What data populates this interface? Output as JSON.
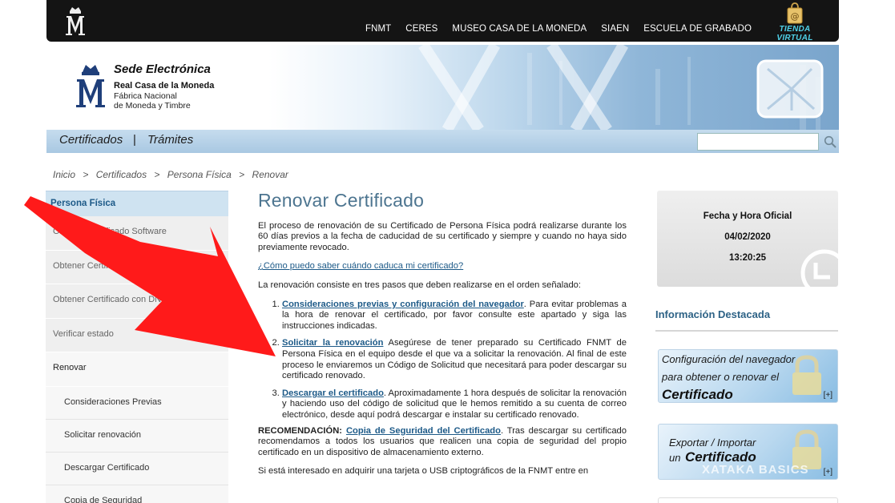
{
  "topbar": {
    "nav": [
      "FNMT",
      "CERES",
      "MUSEO CASA DE LA MONEDA",
      "SIAEN",
      "ESCUELA DE GRABADO"
    ],
    "tienda": "TIENDA VIRTUAL",
    "tienda_icon": "shopping-bag-icon"
  },
  "header": {
    "title": "Sede Electrónica",
    "org": "Real Casa de la Moneda",
    "sub1": "Fábrica Nacional",
    "sub2": "de Moneda y Timbre"
  },
  "navbar": {
    "certificados": "Certificados",
    "separator": "|",
    "tramites": "Trámites",
    "search_value": ""
  },
  "breadcrumb": [
    "Inicio",
    ">",
    "Certificados",
    ">",
    "Persona Física",
    ">",
    "Renovar"
  ],
  "sidebar": {
    "heading": "Persona Física",
    "items": [
      "Obtener Certificado Software",
      "Obtener Certificado con Android",
      "Obtener Certificado con DNIe",
      "Verificar estado",
      "Renovar"
    ],
    "subitems": [
      "Consideraciones Previas",
      "Solicitar renovación",
      "Descargar Certificado",
      "Copia de Seguridad"
    ]
  },
  "main": {
    "title": "Renovar Certificado",
    "intro": "El proceso de renovación de su Certificado de Persona Física podrá realizarse durante los 60 días previos a la fecha de caducidad de su certificado y siempre y cuando no haya sido previamente revocado.",
    "link_caduca": "¿Cómo puedo saber cuándo caduca mi certificado?",
    "steps_intro": "La renovación consiste en tres pasos que deben realizarse en el orden señalado:",
    "steps": [
      {
        "link": "Consideraciones previas y configuración del navegador",
        "text": ". Para evitar problemas a la hora de renovar el certificado, por favor consulte este apartado y siga las instrucciones indicadas."
      },
      {
        "link": "Solicitar la renovación",
        "text": " Asegúrese de tener preparado su Certificado FNMT de Persona Física en el equipo desde el que va a solicitar la renovación. Al final de este proceso le enviaremos un Código de Solicitud que necesitará para poder descargar su certificado renovado."
      },
      {
        "link": "Descargar el certificado",
        "text": ". Aproximadamente 1 hora después de solicitar la renovación y haciendo uso del código de solicitud que le hemos remitido a su cuenta de correo electrónico, desde aquí podrá descargar e instalar su certificado renovado."
      }
    ],
    "rec_label": "RECOMENDACIÓN:",
    "rec_link": "Copia de Seguridad del Certificado",
    "rec_text": ". Tras descargar su certificado recomendamos a todos los usuarios que realicen una copia de seguridad del propio certificado en un dispositivo de almacenamiento externo.",
    "last_para": "Si está interesado en adquirir una tarjeta o USB criptográficos de la FNMT entre en"
  },
  "datebox": {
    "label": "Fecha y Hora Oficial",
    "date": "04/02/2020",
    "time": "13:20:25"
  },
  "info": {
    "title": "Información Destacada",
    "promo1": {
      "l1": "Configuración del navegador",
      "l2": "para obtener o renovar el",
      "l3": "Certificado",
      "plus": "[+]"
    },
    "promo2": {
      "l1": "Exportar / Importar",
      "l2": "un",
      "l3": "Certificado",
      "plus": "[+]"
    }
  },
  "watermark": "XATAKA BASICS",
  "colors": {
    "accent": "#1d5a88",
    "arrow": "#ff1a1a",
    "topbar": "#141414"
  }
}
